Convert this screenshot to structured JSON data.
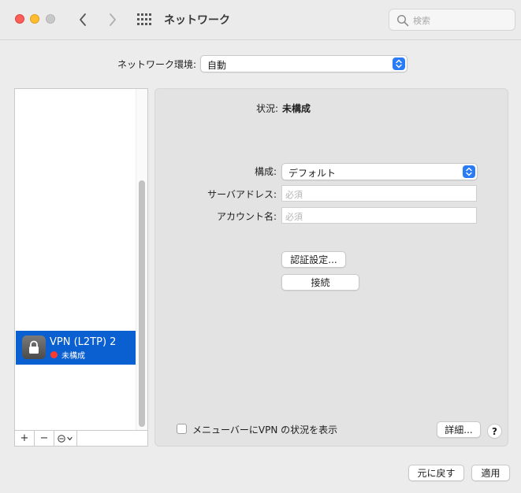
{
  "window": {
    "title": "ネットワーク",
    "search_placeholder": "検索"
  },
  "location": {
    "label": "ネットワーク環境:",
    "value": "自動"
  },
  "sidebar": {
    "services": [
      {
        "name": "VPN (L2TP) 2",
        "status": "未構成",
        "status_color": "#ff3b30",
        "icon": "lock-icon"
      }
    ],
    "toolbar": {
      "add": "+",
      "remove": "−"
    }
  },
  "detail": {
    "status_label": "状況:",
    "status_value": "未構成",
    "config_label": "構成:",
    "config_value": "デフォルト",
    "server_label": "サーバアドレス:",
    "server_placeholder": "必須",
    "account_label": "アカウント名:",
    "account_placeholder": "必須",
    "auth_button": "認証設定...",
    "connect_button": "接続",
    "show_vpn_status_label": "メニューバーにVPN の状況を表示",
    "show_vpn_status_checked": false,
    "advanced_button": "詳細...",
    "help_button": "?"
  },
  "footer": {
    "revert_button": "元に戻す",
    "apply_button": "適用"
  },
  "colors": {
    "accent": "#2a7cf6",
    "selection": "#0a5fd1"
  }
}
